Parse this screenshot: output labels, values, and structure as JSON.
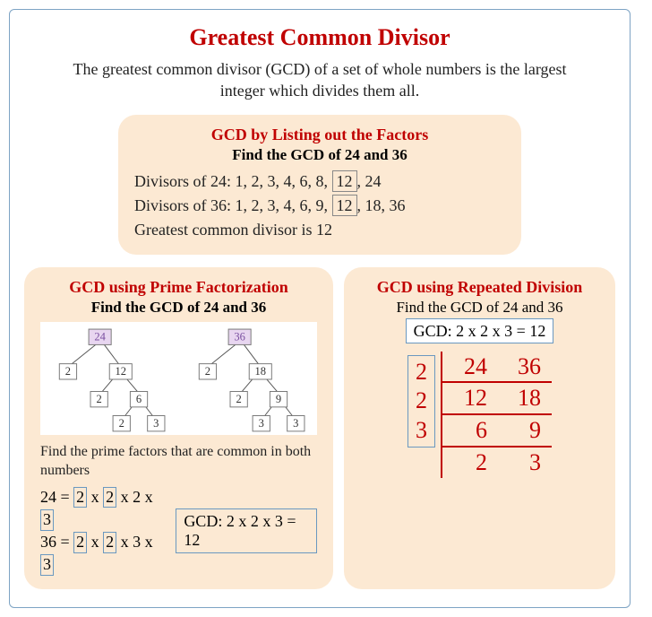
{
  "title": "Greatest Common Divisor",
  "definition": "The greatest common divisor (GCD) of a set of whole numbers is the largest integer which divides them all.",
  "listing": {
    "title": "GCD by Listing out the Factors",
    "subtitle": "Find the GCD of 24 and 36",
    "div24_label": "Divisors of 24: ",
    "div24_pre": "1, 2, 3, 4, 6, 8, ",
    "div24_hl": "12",
    "div24_post": ", 24",
    "div36_label": "Divisors of 36: ",
    "div36_pre": "1, 2, 3, 4, 6, 9, ",
    "div36_hl": "12",
    "div36_post": ", 18, 36",
    "result": "Greatest common divisor is 12"
  },
  "prime": {
    "title": "GCD using Prime Factorization",
    "subtitle": "Find the GCD of 24 and 36",
    "tree24_root": "24",
    "tree36_root": "36",
    "tree24": {
      "a": "2",
      "b": "12",
      "c": "2",
      "d": "6",
      "e": "2",
      "f": "3"
    },
    "tree36": {
      "a": "2",
      "b": "18",
      "c": "2",
      "d": "9",
      "e": "3",
      "f": "3"
    },
    "explain": "Find the prime factors that are common in both numbers",
    "eq24_lhs": "24 = ",
    "eq24_b1": "2",
    "eq24_x1": " x ",
    "eq24_b2": "2",
    "eq24_x2": " x 2 x ",
    "eq24_b3": "3",
    "eq36_lhs": "36 = ",
    "eq36_b1": "2",
    "eq36_x1": " x ",
    "eq36_b2": "2",
    "eq36_x2": " x 3 x ",
    "eq36_b3": "3",
    "result": "GCD: 2 x 2 x 3 = 12"
  },
  "repeated": {
    "title": "GCD using Repeated Division",
    "subtitle": "Find the GCD of 24 and 36",
    "result": "GCD: 2 x 2 x 3 = 12",
    "left": [
      "2",
      "2",
      "3"
    ],
    "rows": [
      [
        "24",
        "36"
      ],
      [
        "12",
        "18"
      ],
      [
        "6",
        "9"
      ],
      [
        "2",
        "3"
      ]
    ]
  }
}
